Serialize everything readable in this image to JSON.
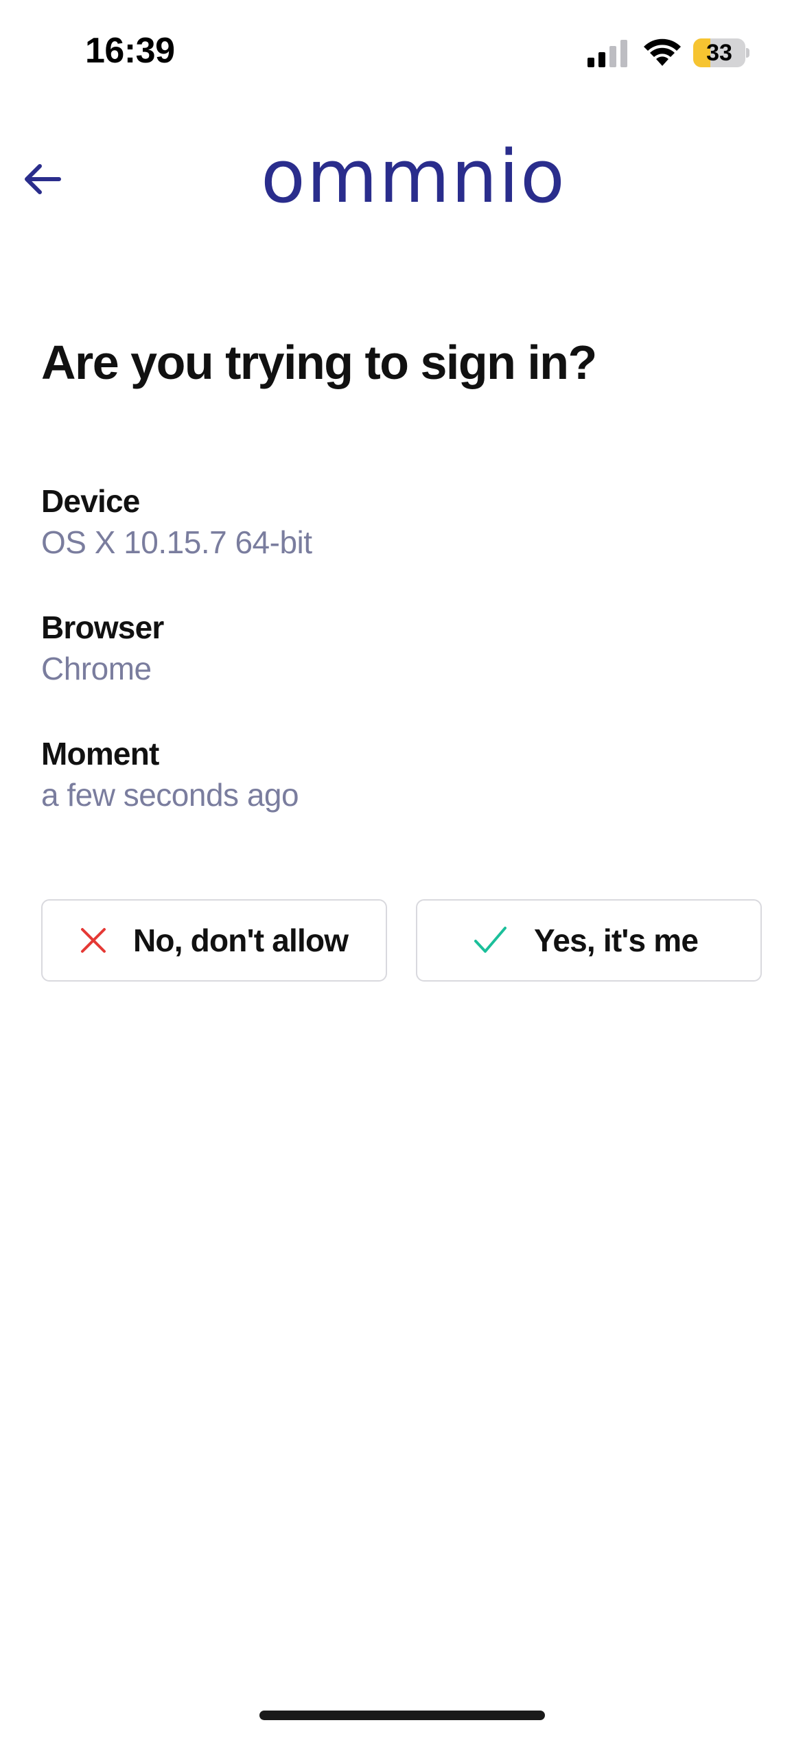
{
  "status_bar": {
    "time": "16:39",
    "battery_level": "33",
    "battery_fraction": 0.33,
    "signal_icon": "cellular-signal-icon",
    "wifi_icon": "wifi-icon",
    "battery_icon": "battery-icon"
  },
  "header": {
    "back_icon": "arrow-left-icon",
    "logo_text": "ommnio"
  },
  "prompt": {
    "title": "Are you trying to sign in?"
  },
  "details": [
    {
      "label": "Device",
      "value": "OS X 10.15.7 64-bit"
    },
    {
      "label": "Browser",
      "value": "Chrome"
    },
    {
      "label": "Moment",
      "value": "a few seconds ago"
    }
  ],
  "actions": {
    "deny_label": "No, don't allow",
    "deny_icon": "close-icon",
    "allow_label": "Yes, it's me",
    "allow_icon": "checkmark-icon"
  },
  "colors": {
    "brand": "#2a2d8c",
    "deny_icon": "#e53935",
    "allow_icon": "#1bbf9a",
    "value_text": "#7a7d9e",
    "battery_fill": "#f6c431"
  }
}
